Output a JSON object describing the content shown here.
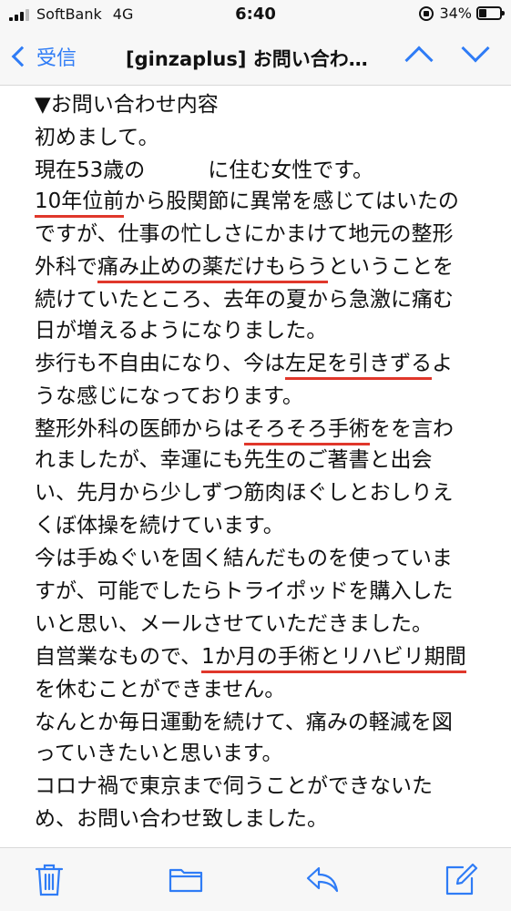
{
  "status_bar": {
    "carrier": "SoftBank",
    "network": "4G",
    "time": "6:40",
    "battery": "34%"
  },
  "nav": {
    "back_label": "受信",
    "title": "[ginzaplus] お問い合わ…"
  },
  "email_body": {
    "lines": [
      [
        {
          "text": "▼お問い合わせ内容",
          "hl": false
        }
      ],
      [
        {
          "text": "初めまして。",
          "hl": false
        }
      ],
      [
        {
          "text": "現在53歳の　　　に住む女性です。",
          "hl": false
        }
      ],
      [
        {
          "text": "10年位前",
          "hl": true
        },
        {
          "text": "から股関節に異常を感じてはいたの",
          "hl": false
        }
      ],
      [
        {
          "text": "ですが、仕事の忙しさにかまけて地元の整形",
          "hl": false
        }
      ],
      [
        {
          "text": "外科で",
          "hl": false
        },
        {
          "text": "痛み止めの薬だけもらう",
          "hl": true
        },
        {
          "text": "ということを",
          "hl": false
        }
      ],
      [
        {
          "text": "続けていたところ、去年の夏から急激に痛む",
          "hl": false
        }
      ],
      [
        {
          "text": "日が増えるようになりました。",
          "hl": false
        }
      ],
      [
        {
          "text": "歩行も不自由になり、今は",
          "hl": false
        },
        {
          "text": "左足を引きずる",
          "hl": true
        },
        {
          "text": "よ",
          "hl": false
        }
      ],
      [
        {
          "text": "うな感じになっております。",
          "hl": false
        }
      ],
      [
        {
          "text": "整形外科の医師からは",
          "hl": false
        },
        {
          "text": "そろそろ手術",
          "hl": true
        },
        {
          "text": "をを言わ",
          "hl": false
        }
      ],
      [
        {
          "text": "れましたが、幸運にも先生のご著書と出会",
          "hl": false
        }
      ],
      [
        {
          "text": "い、先月から少しずつ筋肉ほぐしとおしりえ",
          "hl": false
        }
      ],
      [
        {
          "text": "くぼ体操を続けています。",
          "hl": false
        }
      ],
      [
        {
          "text": "今は手ぬぐいを固く結んだものを使っていま",
          "hl": false
        }
      ],
      [
        {
          "text": "すが、可能でしたらトライポッドを購入した",
          "hl": false
        }
      ],
      [
        {
          "text": "いと思い、メールさせていただきました。",
          "hl": false
        }
      ],
      [
        {
          "text": "自営業なもので、",
          "hl": false
        },
        {
          "text": "1か月の手術とリハビリ期間",
          "hl": true
        }
      ],
      [
        {
          "text": "を休むことができません。",
          "hl": false
        }
      ],
      [
        {
          "text": "なんとか毎日運動を続けて、痛みの軽減を図",
          "hl": false
        }
      ],
      [
        {
          "text": "っていきたいと思います。",
          "hl": false
        }
      ],
      [
        {
          "text": "コロナ禍で東京まで伺うことができないた",
          "hl": false
        }
      ],
      [
        {
          "text": "め、お問い合わせ致しました。",
          "hl": false
        }
      ]
    ]
  },
  "toolbar": {
    "icons": [
      "trash-icon",
      "folder-icon",
      "reply-icon",
      "compose-icon"
    ]
  },
  "colors": {
    "accent": "#2f7cf6",
    "highlight_underline": "#e0372b"
  }
}
